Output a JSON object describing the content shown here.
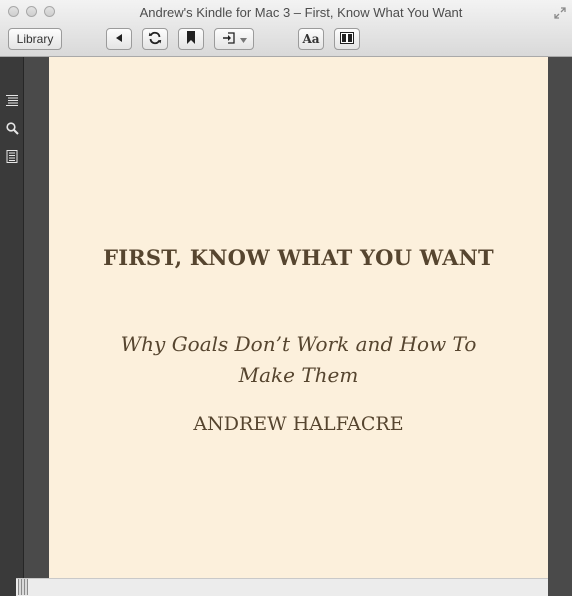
{
  "window": {
    "title": "Andrew's Kindle for Mac 3 – First, Know What You Want"
  },
  "toolbar": {
    "library_label": "Library",
    "back_icon": "back-arrow-icon",
    "sync_icon": "sync-icon",
    "bookmark_icon": "bookmark-icon",
    "goto_icon": "go-to-icon",
    "font_label": "Aa",
    "view_icon": "two-column-view-icon"
  },
  "sidebar": {
    "items": [
      {
        "icon": "table-of-contents-icon"
      },
      {
        "icon": "search-icon"
      },
      {
        "icon": "notes-icon"
      }
    ]
  },
  "book": {
    "title": "FIRST, KNOW WHAT YOU WANT",
    "subtitle": "Why Goals Don’t Work and How To Make Them",
    "author": "ANDREW HALFACRE"
  },
  "colors": {
    "page_background": "#fcf0dc",
    "text": "#56452f",
    "surround": "#4a4a4a",
    "sidebar": "#3a3a3a"
  }
}
